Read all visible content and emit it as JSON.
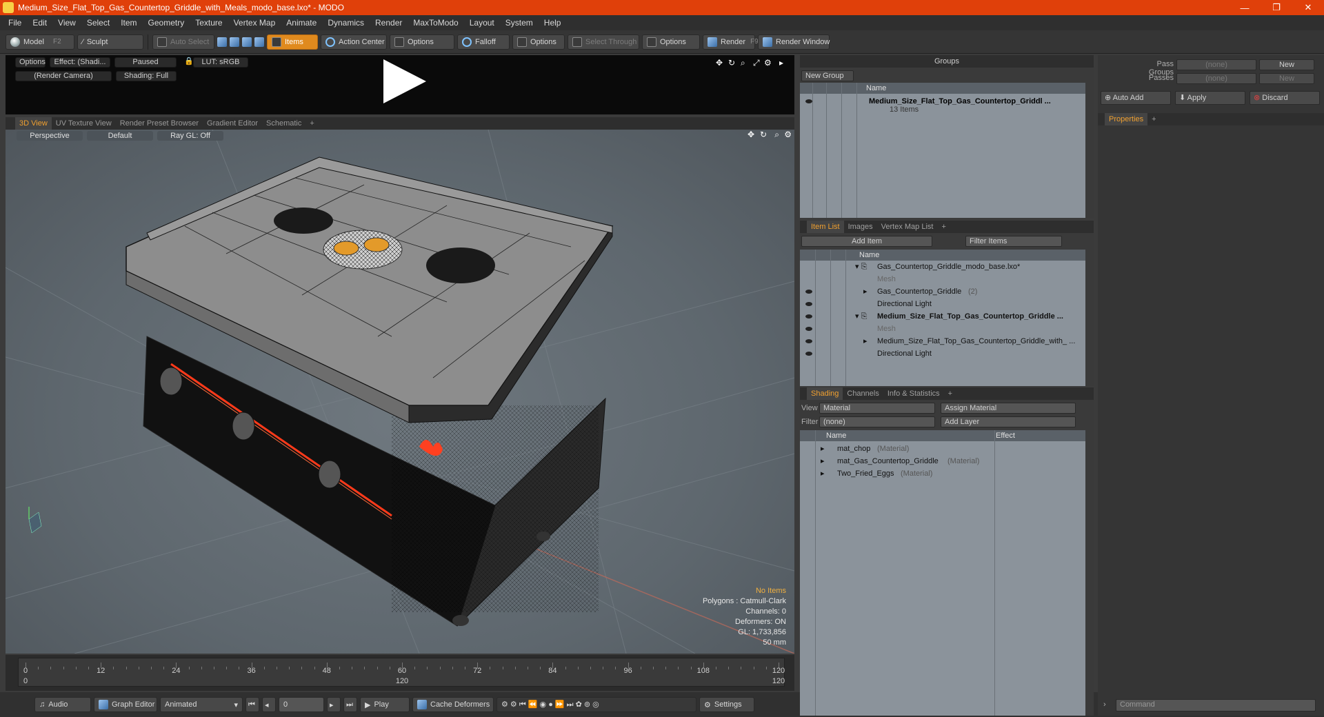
{
  "title": "Medium_Size_Flat_Top_Gas_Countertop_Griddle_with_Meals_modo_base.lxo* - MODO",
  "window_controls": [
    "—",
    "❐",
    "✕"
  ],
  "menu": [
    "File",
    "Edit",
    "View",
    "Select",
    "Item",
    "Geometry",
    "Texture",
    "Vertex Map",
    "Animate",
    "Dynamics",
    "Render",
    "MaxToModo",
    "Layout",
    "System",
    "Help"
  ],
  "toolbar": {
    "model": "Model",
    "model_key": "F2",
    "sculpt": "Sculpt",
    "auto_select": "Auto Select",
    "items": "Items",
    "action_center": "Action Center",
    "options1": "Options",
    "falloff": "Falloff",
    "options2": "Options",
    "select_through": "Select Through",
    "options3": "Options",
    "render": "Render",
    "render_key": "F9",
    "render_window": "Render Window"
  },
  "preview": {
    "options": "Options",
    "effect": "Effect: (Shadi...",
    "paused": "Paused",
    "lut": "LUT: sRGB",
    "camera": "(Render Camera)",
    "shading": "Shading: Full"
  },
  "viewport_tabs": [
    "3D View",
    "UV Texture View",
    "Render Preset Browser",
    "Gradient Editor",
    "Schematic",
    "+"
  ],
  "viewport": {
    "perspective": "Perspective",
    "default": "Default",
    "raygl": "Ray GL: Off",
    "stats": {
      "no_items": "No Items",
      "polygons": "Polygons : Catmull-Clark",
      "channels": "Channels: 0",
      "deformers": "Deformers: ON",
      "gl": "GL: 1,733,856",
      "unit": "50 mm"
    }
  },
  "timeline": {
    "ticks": [
      "0",
      "12",
      "24",
      "36",
      "48",
      "60",
      "72",
      "84",
      "96",
      "108",
      "120"
    ],
    "sub_ticks": [
      "0",
      "120",
      "120"
    ]
  },
  "bottombar": {
    "audio": "Audio",
    "graph_editor": "Graph Editor",
    "animated": "Animated",
    "frame": "0",
    "play": "Play",
    "cache_deformers": "Cache Deformers",
    "settings": "Settings"
  },
  "groups": {
    "title": "Groups",
    "new_group": "New Group",
    "col_name": "Name",
    "item_name": "Medium_Size_Flat_Top_Gas_Countertop_Griddl ...",
    "item_count": "13 Items"
  },
  "item_list": {
    "tabs": [
      "Item List",
      "Images",
      "Vertex Map List",
      "+"
    ],
    "add_item": "Add Item",
    "filter_items": "Filter Items",
    "col_name": "Name",
    "rows": [
      {
        "label": "Gas_Countertop_Griddle_modo_base.lxo*",
        "sub": ""
      },
      {
        "label": "Mesh",
        "sub": ""
      },
      {
        "label": "Gas_Countertop_Griddle",
        "sub": "(2)"
      },
      {
        "label": "Directional Light",
        "sub": ""
      },
      {
        "label": "Medium_Size_Flat_Top_Gas_Countertop_Griddle ...",
        "sub": ""
      },
      {
        "label": "Mesh",
        "sub": ""
      },
      {
        "label": "Medium_Size_Flat_Top_Gas_Countertop_Griddle_with_ ...",
        "sub": ""
      },
      {
        "label": "Directional Light",
        "sub": ""
      }
    ]
  },
  "shading": {
    "tabs": [
      "Shading",
      "Channels",
      "Info & Statistics",
      "+"
    ],
    "view_label": "View",
    "view_value": "Material",
    "assign": "Assign Material",
    "filter_label": "Filter",
    "filter_value": "(none)",
    "add_layer": "Add Layer",
    "col_name": "Name",
    "col_effect": "Effect",
    "rows": [
      {
        "label": "mat_chop",
        "sub": "(Material)"
      },
      {
        "label": "mat_Gas_Countertop_Griddle",
        "sub": "(Material)"
      },
      {
        "label": "Two_Fried_Eggs",
        "sub": "(Material)"
      }
    ]
  },
  "pass_panel": {
    "pass_groups": "Pass Groups",
    "passes": "Passes",
    "none1": "(none)",
    "none2": "(none)",
    "new1": "New",
    "new2": "New",
    "auto_add": "Auto Add",
    "apply": "Apply",
    "discard": "Discard",
    "properties": "Properties",
    "command": "Command"
  },
  "colors": {
    "accent": "#f0a030",
    "titlebar": "#e0400a"
  }
}
